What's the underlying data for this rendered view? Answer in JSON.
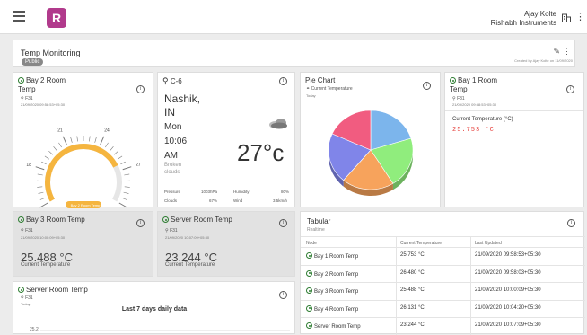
{
  "topbar": {
    "logo_letter": "R",
    "user_name": "Ajay Kolte",
    "user_org": "Rishabh Instruments"
  },
  "dashboard": {
    "title": "Temp Monitoring",
    "badge": "Public",
    "created_by": "Created by Ajay Kolte on 11/09/2020"
  },
  "gauge_widget": {
    "title_line1": "Bay 2 Room",
    "title_line2": "Temp",
    "device": "F31",
    "timestamp": "21/09/2020 09:58:53+05:30",
    "ticks": [
      "15",
      "18",
      "21",
      "24",
      "27",
      "30"
    ],
    "min": 15,
    "max": 30,
    "value": 26.48,
    "footer": "Bay 2 Room Temp"
  },
  "weather_widget": {
    "location": "C-6",
    "city": "Nashik,",
    "country": "IN",
    "day": "Mon",
    "time": "10:06",
    "ampm": "AM",
    "condition_line1": "Broken",
    "condition_line2": "clouds",
    "temperature": "27°c",
    "pressure_label": "Pressure",
    "pressure_value": "1003hPa",
    "humidity_label": "Humidity",
    "humidity_value": "80%",
    "clouds_label": "Clouds",
    "clouds_value": "67%",
    "wind_label": "Wind",
    "wind_value": "3.5km/h"
  },
  "pie_widget": {
    "title": "Pie Chart",
    "subtitle": "Current Temperature",
    "period": "Today",
    "colors": [
      "#7cb5ec",
      "#90ed7d",
      "#f7a35c",
      "#8085e9",
      "#f15c80"
    ]
  },
  "bay1_widget": {
    "title_line1": "Bay 1 Room",
    "title_line2": "Temp",
    "device": "F31",
    "timestamp": "21/09/2020 09:58:53+05:30",
    "label": "Current Temperature (°C)",
    "value": "25.753 °C"
  },
  "bay3_widget": {
    "title": "Bay 3 Room Temp",
    "device": "F31",
    "timestamp": "21/09/2020 10:00:09+05:30",
    "value": "25.488 °C",
    "label": "Current Temperature"
  },
  "server_widget": {
    "title": "Server Room Temp",
    "device": "F31",
    "timestamp": "21/09/2020 10:07:09+05:30",
    "value": "23.244 °C",
    "label": "Current Temperature"
  },
  "tabular_widget": {
    "title": "Tabular",
    "subtitle": "Realtime",
    "columns": [
      "Node",
      "Current Temperature",
      "Last Updated"
    ],
    "rows": [
      [
        "Bay 1 Room Temp",
        "25.753 °C",
        "21/09/2020 09:58:53+05:30"
      ],
      [
        "Bay 2 Room Temp",
        "26.480 °C",
        "21/09/2020 09:58:03+05:30"
      ],
      [
        "Bay 3 Room Temp",
        "25.488 °C",
        "21/09/2020 10:00:09+05:30"
      ],
      [
        "Bay 4 Room Temp",
        "26.131 °C",
        "21/09/2020 10:04:20+05:30"
      ],
      [
        "Server Room Temp",
        "23.244 °C",
        "21/09/2020 10:07:09+05:30"
      ]
    ]
  },
  "daily_widget": {
    "title": "Server Room Temp",
    "device": "F31",
    "period": "Today",
    "chart_title": "Last 7 days daily data",
    "y_tick": "25.2"
  }
}
